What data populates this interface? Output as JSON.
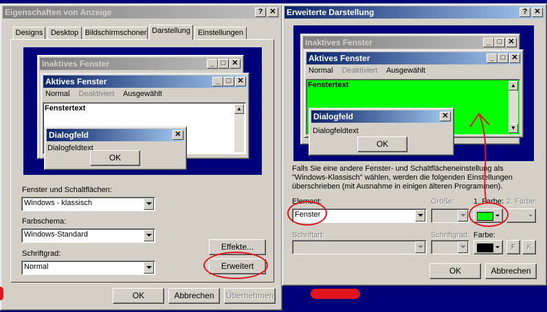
{
  "left_dialog": {
    "title": "Eigenschaften von Anzeige",
    "tabs": [
      "Designs",
      "Desktop",
      "Bildschirmschoner",
      "Darstellung",
      "Einstellungen"
    ],
    "preview": {
      "inactive_title": "Inaktives Fenster",
      "active_title": "Aktives Fenster",
      "menu_normal": "Normal",
      "menu_disabled": "Deaktiviert",
      "menu_selected": "Ausgewählt",
      "window_text": "Fenstertext",
      "dialog_title": "Dialogfeld",
      "dialog_text": "Dialogfeldtext",
      "ok": "OK"
    },
    "windows_buttons_label": "Fenster und Schaltflächen:",
    "windows_buttons_value": "Windows - klassisch",
    "color_scheme_label": "Farbschema:",
    "color_scheme_value": "Windows-Standard",
    "font_size_label": "Schriftgrad:",
    "font_size_value": "Normal",
    "effects_button": "Effekte...",
    "advanced_button": "Erweitert",
    "ok_button": "OK",
    "cancel_button": "Abbrechen",
    "apply_button": "Übernehmen"
  },
  "right_dialog": {
    "title": "Erweiterte Darstellung",
    "preview": {
      "inactive_title": "Inaktives Fenster",
      "active_title": "Aktives Fenster",
      "menu_normal": "Normal",
      "menu_disabled": "Deaktiviert",
      "menu_selected": "Ausgewählt",
      "window_text": "Fenstertext",
      "dialog_title": "Dialogfeld",
      "dialog_text": "Dialogfeldtext",
      "ok": "OK"
    },
    "info_text": "Falls Sie eine andere Fenster- und Schaltflächeneinstellung als \"Windows-Klassisch\" wählen, werden die folgenden Einstellungen überschrieben (mit Ausnahme in einigen älteren Programmen).",
    "element_label": "Element:",
    "element_value": "Fenster",
    "size_label": "Größe:",
    "color1_label": "1. Farbe:",
    "color2_label": "2. Farbe:",
    "font_label": "Schriftart:",
    "font_size_label": "Schriftgrad:",
    "font_color_label": "Farbe:",
    "bold_label": "F",
    "italic_label": "K",
    "ok_button": "OK",
    "cancel_button": "Abbrechen"
  },
  "colors": {
    "desktop": "#00007b",
    "window_face": "#d4d0c8",
    "highlight_window": "#00ff00",
    "annotation": "#e2151c"
  }
}
